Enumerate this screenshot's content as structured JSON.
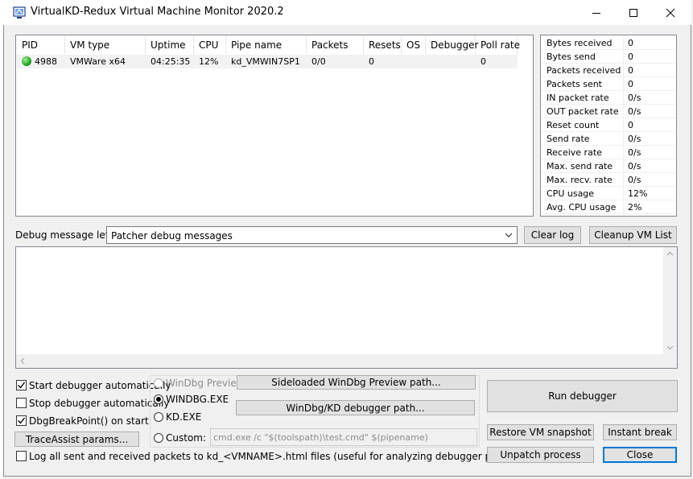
{
  "window": {
    "title": "VirtualKD-Redux Virtual Machine Monitor 2020.2"
  },
  "vm_table": {
    "columns": [
      "PID",
      "VM type",
      "Uptime",
      "CPU",
      "Pipe name",
      "Packets",
      "Resets",
      "OS",
      "Debugger",
      "Poll rate"
    ],
    "rows": [
      {
        "pid": "4988",
        "vm_type": "VMWare x64",
        "uptime": "04:25:35",
        "cpu": "12%",
        "pipe": "kd_VMWIN7SP1",
        "packets": "0/0",
        "resets": "0",
        "os": "",
        "debugger": "",
        "poll_rate": "0",
        "status_color": "#22a822"
      }
    ]
  },
  "stats": [
    {
      "label": "Bytes received",
      "value": "0"
    },
    {
      "label": "Bytes send",
      "value": "0"
    },
    {
      "label": "Packets received",
      "value": "0"
    },
    {
      "label": "Packets sent",
      "value": "0"
    },
    {
      "label": "IN packet rate",
      "value": "0/s"
    },
    {
      "label": "OUT packet rate",
      "value": "0/s"
    },
    {
      "label": "Reset count",
      "value": "0"
    },
    {
      "label": "Send rate",
      "value": "0/s"
    },
    {
      "label": "Receive rate",
      "value": "0/s"
    },
    {
      "label": "Max. send rate",
      "value": "0/s"
    },
    {
      "label": "Max. recv. rate",
      "value": "0/s"
    },
    {
      "label": "CPU usage",
      "value": "12%"
    },
    {
      "label": "Avg. CPU usage",
      "value": "2%"
    }
  ],
  "debug": {
    "level_label": "Debug message level:",
    "level_value": "Patcher debug messages",
    "clear_log": "Clear log",
    "cleanup_vm_list": "Cleanup VM List"
  },
  "options": {
    "start_debugger_auto": "Start debugger automatically",
    "stop_debugger_auto": "Stop debugger automatically",
    "dbg_break_point": "DbgBreakPoint() on start",
    "traceassist": "TraceAssist params...",
    "log_packets": "Log all sent and received packets to kd_<VMNAME>.html files (useful for analyzing debugger protocol)"
  },
  "debugger_choice": {
    "windbg_preview": "WinDbg Preview",
    "windbg_exe": "WINDBG.EXE",
    "kd_exe": "KD.EXE",
    "custom": "Custom:",
    "sideloaded_path": "Sideloaded WinDbg Preview path...",
    "windbg_kd_path": "WinDbg/KD debugger path...",
    "custom_cmd": "cmd.exe /c \"$(toolspath)\\test.cmd\" $(pipename)"
  },
  "actions": {
    "run_debugger": "Run debugger",
    "restore_snapshot": "Restore VM snapshot",
    "instant_break": "Instant break",
    "unpatch_process": "Unpatch process",
    "close": "Close"
  }
}
